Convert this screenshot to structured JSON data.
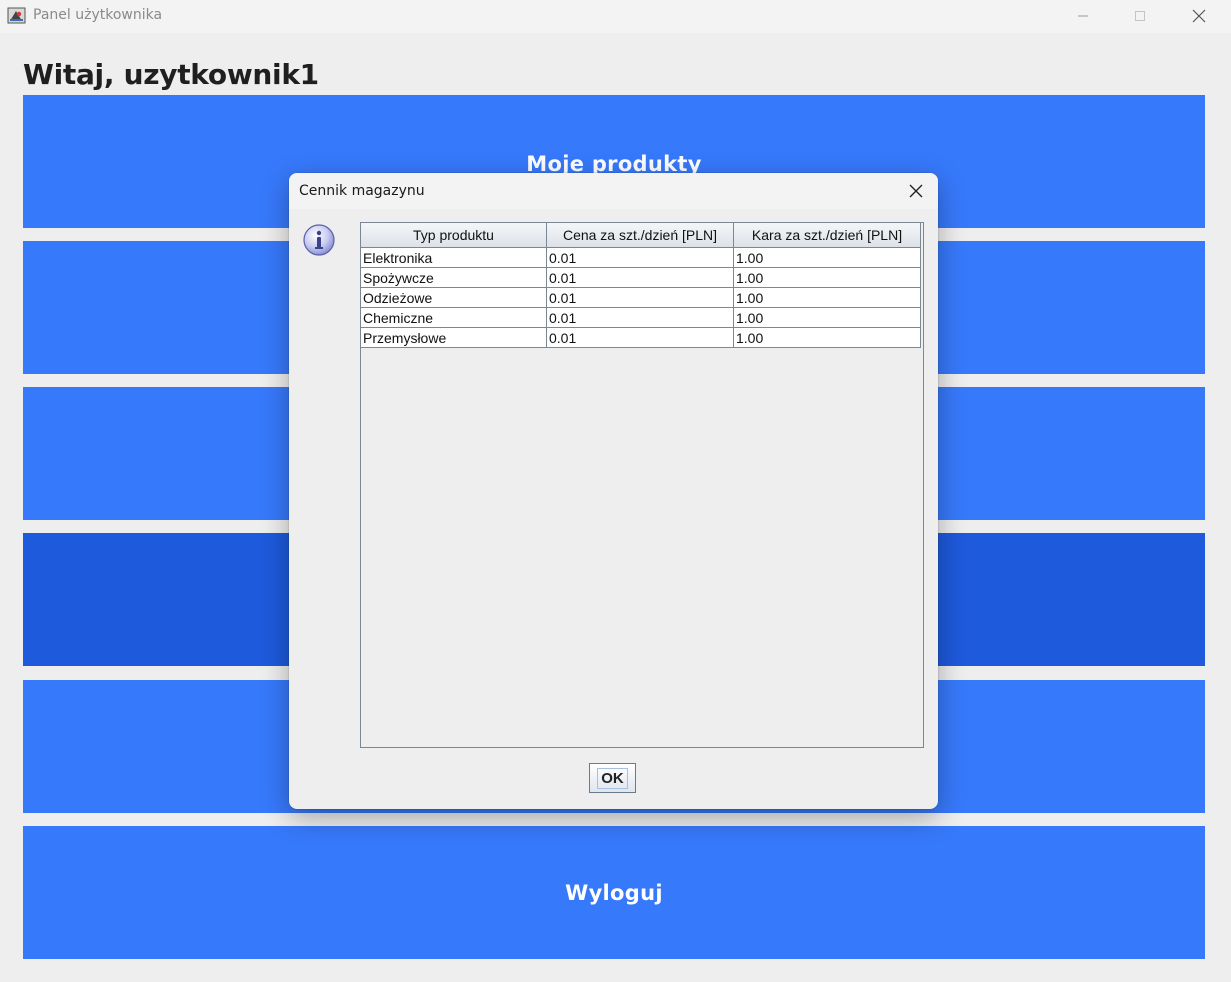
{
  "window": {
    "title": "Panel użytkownika"
  },
  "header": {
    "welcome": "Witaj, uzytkownik1"
  },
  "menu": {
    "items": [
      {
        "label": "Moje produkty"
      },
      {
        "label": ""
      },
      {
        "label": ""
      },
      {
        "label": ""
      },
      {
        "label": ""
      },
      {
        "label": "Wyloguj"
      }
    ]
  },
  "dialog": {
    "title": "Cennik magazynu",
    "ok_label": "OK",
    "table": {
      "headers": [
        "Typ produktu",
        "Cena za szt./dzień [PLN]",
        "Kara za szt./dzień [PLN]"
      ],
      "rows": [
        [
          "Elektronika",
          "0.01",
          "1.00"
        ],
        [
          "Spożywcze",
          "0.01",
          "1.00"
        ],
        [
          "Odzieżowe",
          "0.01",
          "1.00"
        ],
        [
          "Chemiczne",
          "0.01",
          "1.00"
        ],
        [
          "Przemysłowe",
          "0.01",
          "1.00"
        ]
      ]
    }
  },
  "colors": {
    "button_blue": "#3779fb",
    "button_blue_hover": "#1e5adc",
    "background": "#eeeeee"
  },
  "icons": {
    "app": "java-app-icon",
    "info": "info-icon",
    "close": "close-icon"
  }
}
